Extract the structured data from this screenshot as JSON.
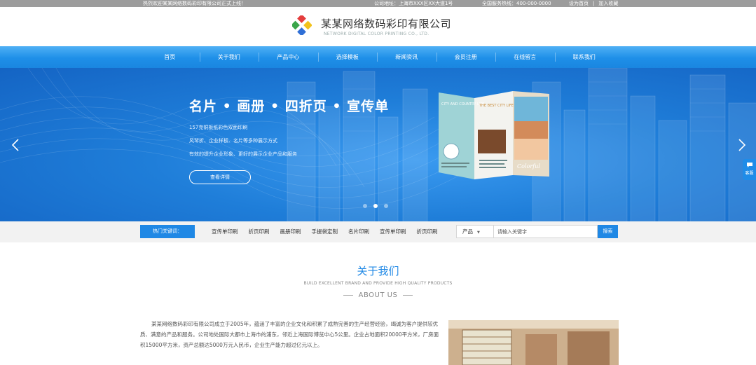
{
  "topbar": {
    "welcome": "热烈欢迎某某网络数码彩印有限公司正式上线！",
    "address": "公司地址：上海市XXX区XX大道1号",
    "hotline": "全国服务热线：400-000-0000",
    "set_home": "设为首页",
    "separator": "|",
    "add_favorite": "加入收藏"
  },
  "header": {
    "company_name": "某某网络数码彩印有限公司",
    "company_en": "NETWORK DIGITAL COLOR PRINTING CO., LTD.",
    "logo_colors": [
      "#e43d3d",
      "#f2c21b",
      "#3aa54a",
      "#2f6fd6"
    ]
  },
  "nav": {
    "items": [
      "首页",
      "关于我们",
      "产品中心",
      "选择模板",
      "新闻资讯",
      "会员注册",
      "在线留言",
      "联系我们"
    ]
  },
  "banner": {
    "title": "名片 • 画册 • 四折页 • 宣传单",
    "lines": [
      "157克铜板纸彩色双面印刷",
      "风琴折、企业样板、名片等多种展示方式",
      "有效的提升企业形象、更好的展示企业产品和服务"
    ],
    "button": "查看详情",
    "brochure_text": [
      "CITY AND COUNTRY LIFE",
      "THE BEST CITY LIFE",
      "Colorful"
    ],
    "active_slide": 2,
    "slide_count": 3,
    "side_tab": "客服"
  },
  "keywords": {
    "label": "热门关键词：",
    "items": [
      "宣传单印刷",
      "折页印刷",
      "画册印刷",
      "手提袋定制",
      "名片印刷",
      "宣传单印刷",
      "折页印刷"
    ]
  },
  "search": {
    "category": "产品",
    "placeholder": "请输入关键字",
    "button": "搜索"
  },
  "about": {
    "title": "关于我们",
    "subtitle_en": "BUILD EXCELLENT BRAND AND PROVIDE HIGH QUALITY PRODUCTS",
    "label": "ABOUT US",
    "text": "某某网络数码彩印有限公司成立于2005年，蕴涵了丰富的企业文化和积累了成熟完善的生产经营经验，竭诚为客户提供较优质、满意的产品和服务。公司地处国际大都市上海市的浦东，邻近上海国际博览中心5公里。企业占地面积20000平方米，厂房面积15000平方米，资产总额达5000万元人民币，企业生产能力超过亿元以上。"
  },
  "colors": {
    "accent": "#1f88e5",
    "topbar": "#9c9c9c",
    "nav": "#1e8fe8"
  }
}
